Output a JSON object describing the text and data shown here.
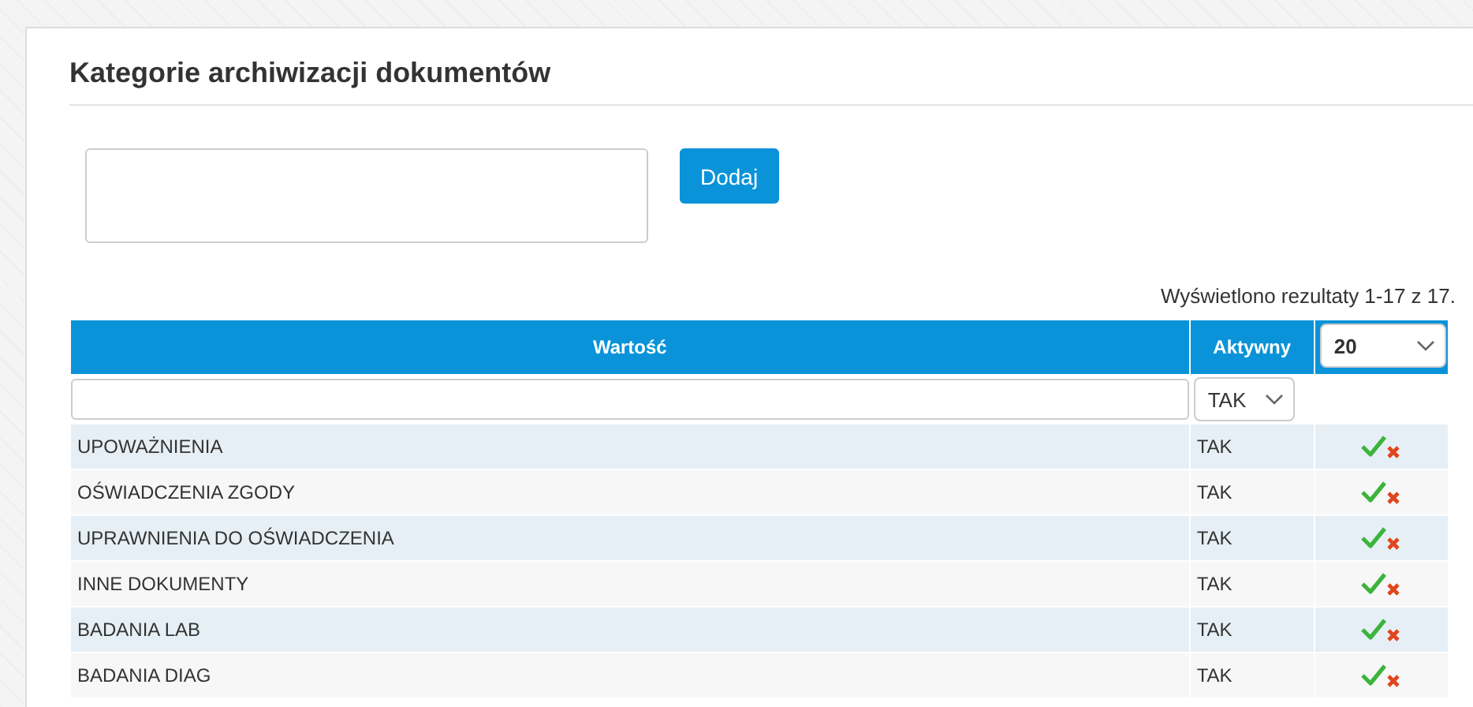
{
  "title": "Kategorie archiwizacji dokumentów",
  "add_button": "Dodaj",
  "results_text": "Wyświetlono rezultaty 1-17 z 17.",
  "table": {
    "columns": [
      "Wartość",
      "Aktywny"
    ],
    "page_size": "20",
    "filter_active": "TAK",
    "rows": [
      {
        "value": "UPOWAŻNIENIA",
        "active": "TAK"
      },
      {
        "value": "OŚWIADCZENIA ZGODY",
        "active": "TAK"
      },
      {
        "value": "UPRAWNIENIA DO OŚWIADCZENIA",
        "active": "TAK"
      },
      {
        "value": "INNE DOKUMENTY",
        "active": "TAK"
      },
      {
        "value": "BADANIA LAB",
        "active": "TAK"
      },
      {
        "value": "BADANIA DIAG",
        "active": "TAK"
      }
    ]
  }
}
